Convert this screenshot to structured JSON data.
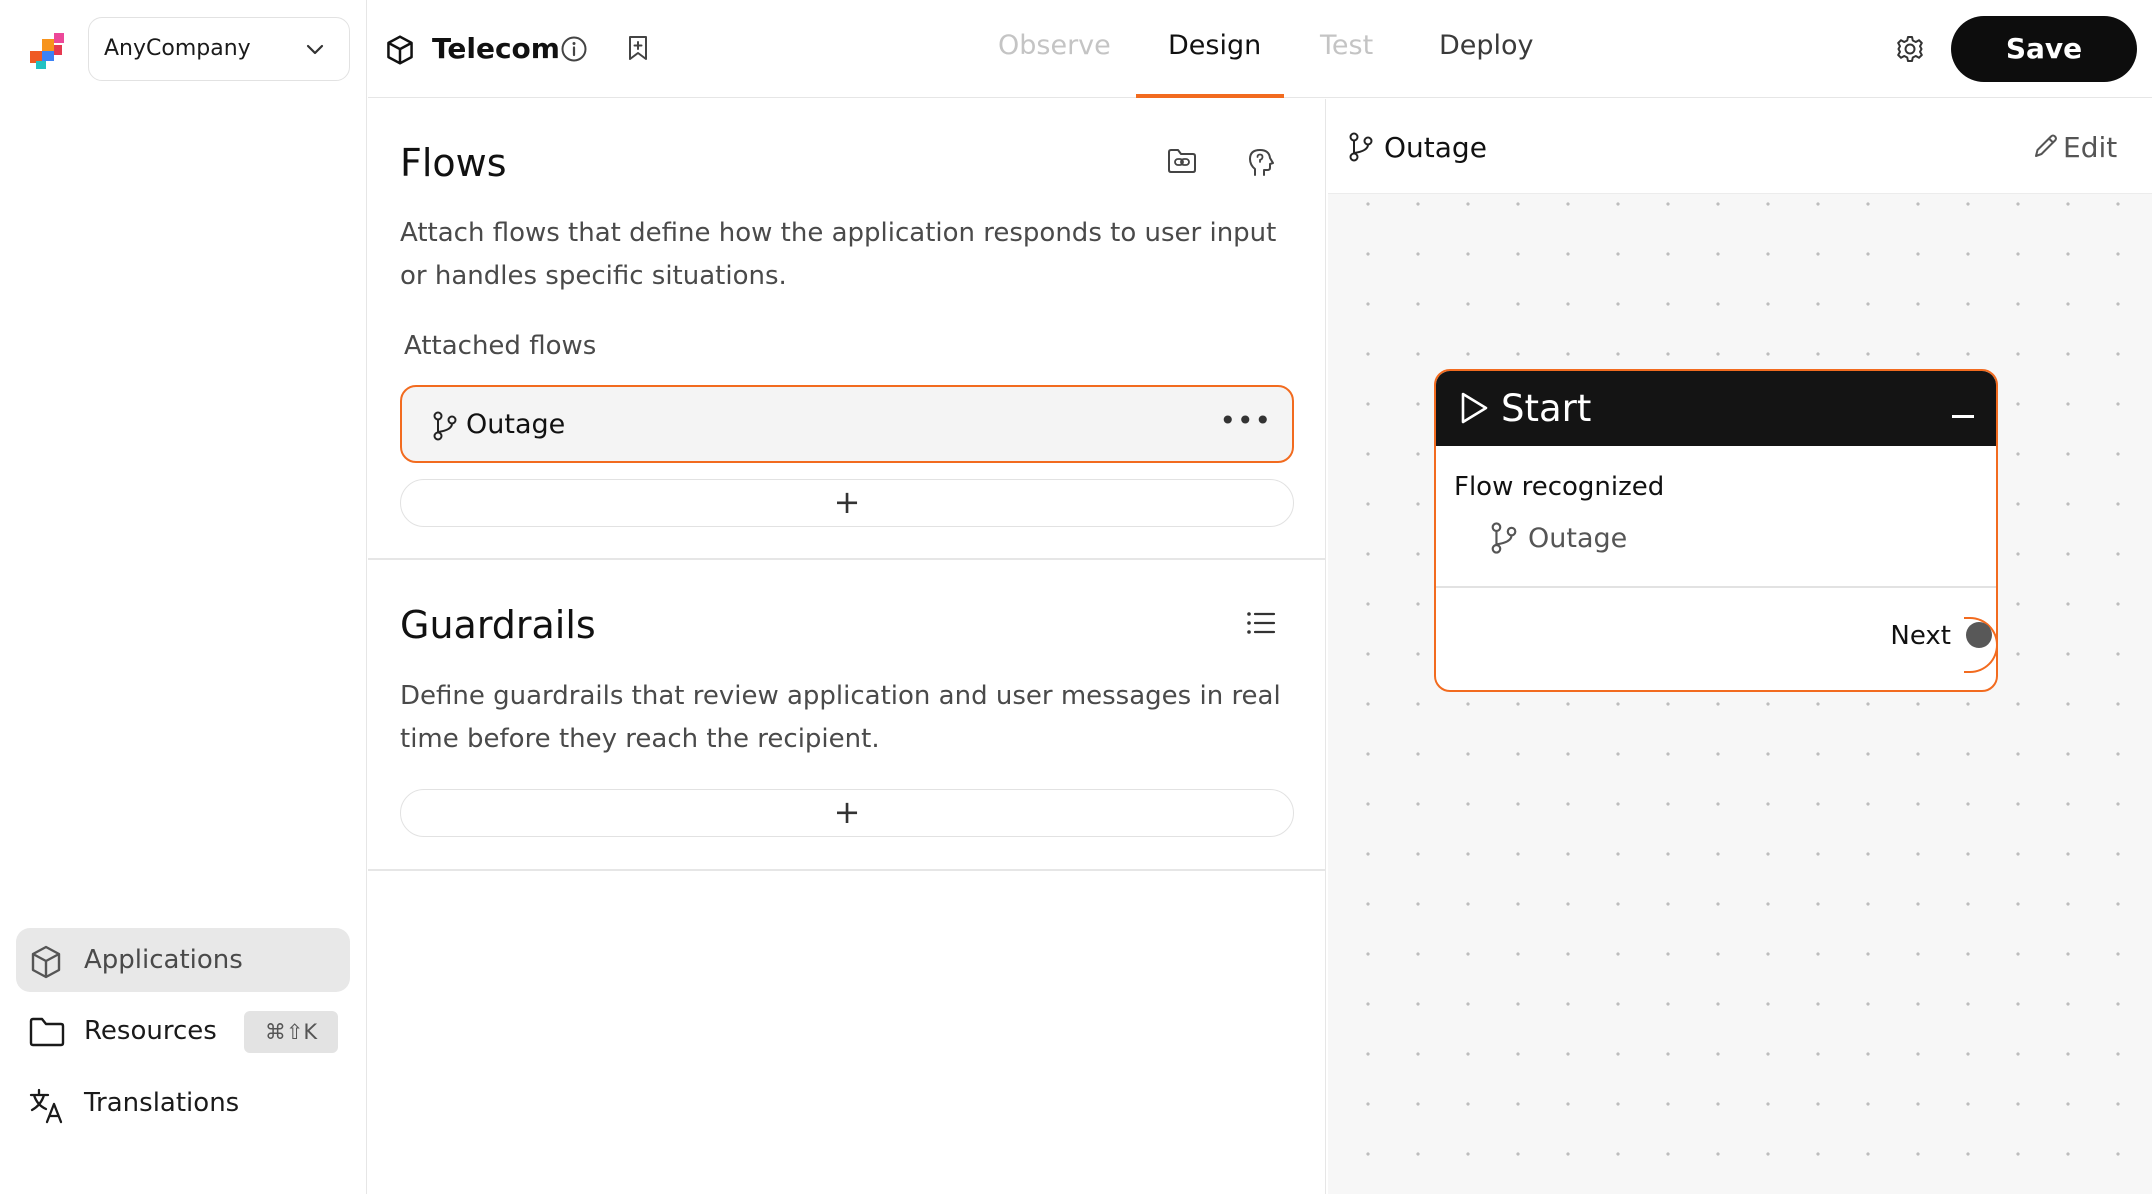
{
  "org": {
    "name": "AnyCompany"
  },
  "nav": {
    "applications": "Applications",
    "resources": "Resources",
    "resources_shortcut": "⌘⇧K",
    "translations": "Translations"
  },
  "header": {
    "app_name": "Telecom",
    "tabs": [
      "Observe",
      "Design",
      "Test",
      "Deploy"
    ],
    "active_tab": "Design",
    "save_label": "Save"
  },
  "flows": {
    "title": "Flows",
    "description": "Attach flows that define how the application responds to user input or handles specific situations.",
    "attached_label": "Attached flows",
    "items": [
      {
        "label": "Outage",
        "menu": "•••"
      }
    ],
    "add_symbol": "+"
  },
  "guardrails": {
    "title": "Guardrails",
    "description": "Define guardrails that review application and user messages in real time before they reach the recipient.",
    "add_symbol": "+"
  },
  "canvas": {
    "title": "Outage",
    "edit_label": "Edit",
    "node": {
      "title": "Start",
      "condition": "Flow recognized",
      "flow_label": "Outage",
      "output_label": "Next"
    }
  },
  "colors": {
    "accent": "#f26b1f",
    "primary_button": "#0d0d0d",
    "node_header": "#141414",
    "canvas_bg": "#f7f7f7",
    "nav_active_bg": "#e8e8e8"
  },
  "icons": {
    "logo": "company-logo-icon",
    "org_chevron": "chevron-down-icon",
    "applications": "cube-icon",
    "resources": "folder-icon",
    "translations": "translate-icon",
    "app": "cube-icon",
    "info": "info-icon",
    "bookmark": "bookmark-icon",
    "settings": "gear-icon",
    "flow": "branch-icon",
    "folder_link": "folder-link-icon",
    "guardrails_head": "head-profile-icon",
    "list": "list-icon",
    "edit": "pencil-icon",
    "play": "play-icon",
    "minimize": "minimize-icon"
  }
}
